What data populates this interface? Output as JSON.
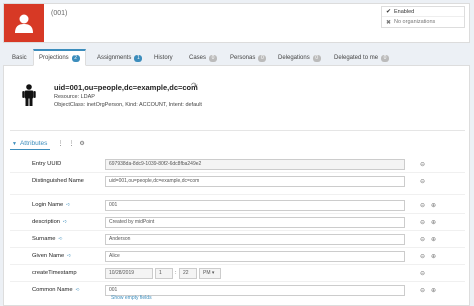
{
  "header": {
    "name": "(001)",
    "status": [
      {
        "icon": "check-icon",
        "glyph": "✔",
        "label": "Enabled"
      },
      {
        "icon": "close-icon",
        "glyph": "✖",
        "label": "No organizations"
      }
    ],
    "avatar_color": "#d73925"
  },
  "tabs": [
    {
      "label": "Basic",
      "badge": ""
    },
    {
      "label": "Projections",
      "badge": "2"
    },
    {
      "label": "Assignments",
      "badge": "1"
    },
    {
      "label": "History",
      "badge": ""
    },
    {
      "label": "Cases",
      "badge": "0"
    },
    {
      "label": "Personas",
      "badge": "0"
    },
    {
      "label": "Delegations",
      "badge": "0"
    },
    {
      "label": "Delegated to me",
      "badge": "0"
    }
  ],
  "projection": {
    "title": "uid=001,ou=people,dc=example,dc=com",
    "resource": "Resource: LDAP",
    "object_class": "ObjectClass: inetOrgPerson, Kind: ACCOUNT, Intent: default"
  },
  "attributes": {
    "heading": "Attributes",
    "rows": [
      {
        "label": "Entry UUID",
        "value": "697938da-8dc9-1039-80f2-6dc8fba249e2"
      },
      {
        "label": "Distinguished Name",
        "value": "uid=001,ou=people,dc=example,dc=com"
      },
      {
        "label": "Login Name",
        "value": "001"
      },
      {
        "label": "description",
        "value": "Created by midPoint"
      },
      {
        "label": "Surname",
        "value": "Anderson"
      },
      {
        "label": "Given Name",
        "value": "Alice"
      },
      {
        "label": "createTimestamp",
        "value": ""
      },
      {
        "label": "Common Name",
        "value": "001"
      }
    ],
    "timestamp": {
      "date": "10/28/2019",
      "hour": "1",
      "minute": "22",
      "ampm": "PM"
    },
    "show_empty": "Show empty fields"
  }
}
